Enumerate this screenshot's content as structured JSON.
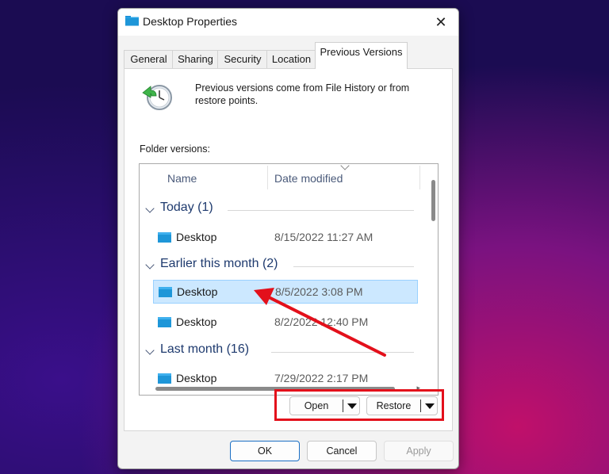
{
  "window": {
    "title": "Desktop Properties",
    "close_glyph": "✕"
  },
  "tabs": [
    {
      "label": "General",
      "active": false
    },
    {
      "label": "Sharing",
      "active": false
    },
    {
      "label": "Security",
      "active": false
    },
    {
      "label": "Location",
      "active": false
    },
    {
      "label": "Previous Versions",
      "active": true
    }
  ],
  "info": {
    "icon": "clock-restore-icon",
    "description": "Previous versions come from File History or from restore points."
  },
  "versions": {
    "label": "Folder versions:",
    "columns": {
      "name": "Name",
      "date": "Date modified"
    },
    "groups": [
      {
        "title": "Today (1)",
        "items": [
          {
            "name": "Desktop",
            "date": "8/15/2022 11:27 AM",
            "selected": false
          }
        ]
      },
      {
        "title": "Earlier this month (2)",
        "items": [
          {
            "name": "Desktop",
            "date": "8/5/2022 3:08 PM",
            "selected": true
          },
          {
            "name": "Desktop",
            "date": "8/2/2022 12:40 PM",
            "selected": false
          }
        ]
      },
      {
        "title": "Last month (16)",
        "items": [
          {
            "name": "Desktop",
            "date": "7/29/2022 2:17 PM",
            "selected": false
          }
        ]
      }
    ]
  },
  "actions": {
    "open": "Open",
    "restore": "Restore"
  },
  "footer": {
    "ok": "OK",
    "cancel": "Cancel",
    "apply": "Apply"
  },
  "colors": {
    "annotation": "#e3101b",
    "selection": "#cce8ff",
    "primary_border": "#1a6fc4"
  }
}
